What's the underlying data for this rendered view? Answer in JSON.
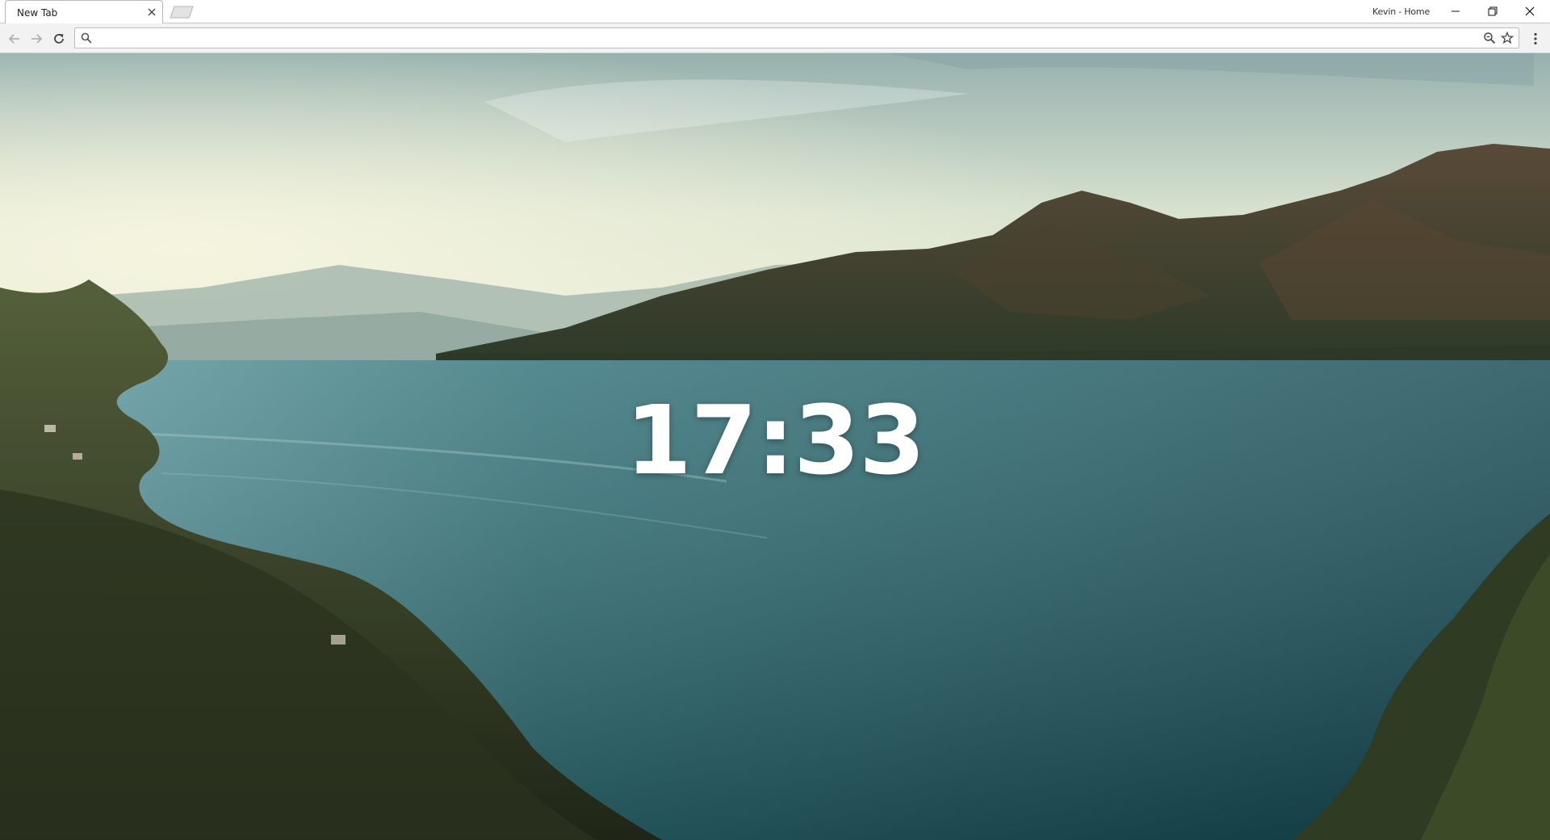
{
  "browser": {
    "tab": {
      "title": "New Tab"
    },
    "profile": "Kevin - Home"
  },
  "omnibox": {
    "value": "",
    "placeholder": ""
  },
  "icons": {
    "back": "back-arrow-icon",
    "forward": "forward-arrow-icon",
    "reload": "reload-icon",
    "search": "search-icon",
    "zoom": "zoom-icon",
    "bookmark": "star-icon",
    "menu": "kebab-menu-icon",
    "minimize": "minimize-icon",
    "restore": "restore-icon",
    "close": "close-icon"
  },
  "page": {
    "clock": "17:33"
  },
  "colors": {
    "sky_top": "#9fb7b4",
    "sky_glow": "#eef2dc",
    "lake": "#1f5a63",
    "mountains": "#3f4a33",
    "forest": "#2b3320"
  }
}
